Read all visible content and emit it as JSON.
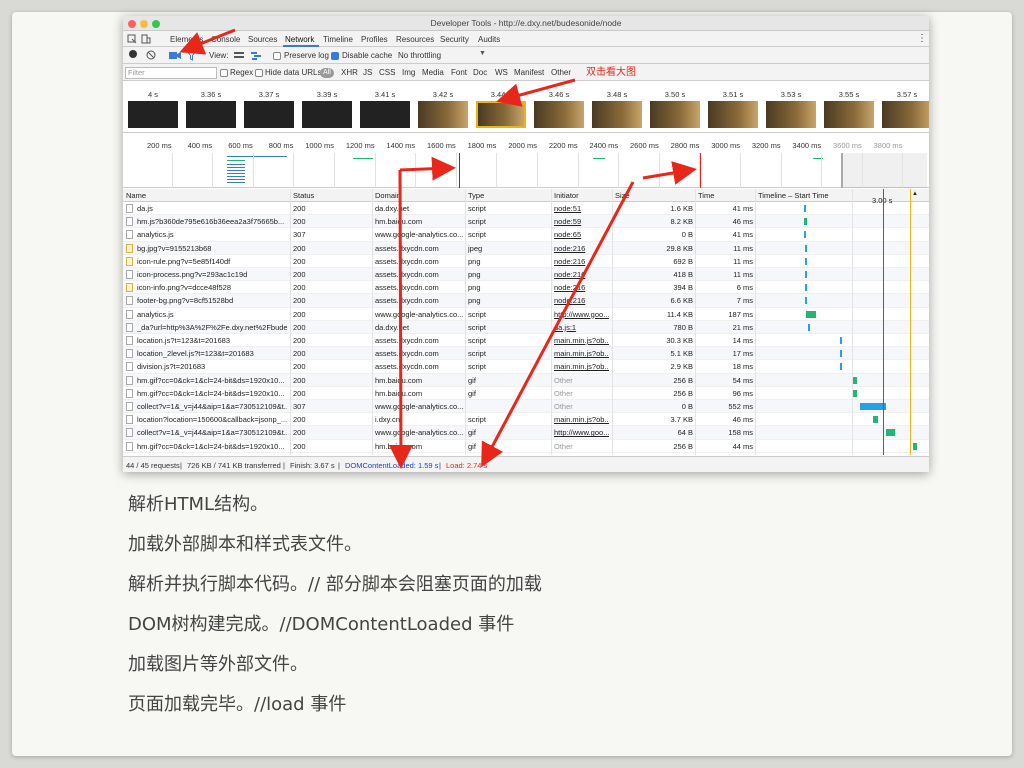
{
  "window": {
    "title": "Developer Tools - http://e.dxy.net/budesonide/node"
  },
  "tabs": [
    "Elements",
    "Console",
    "Sources",
    "Network",
    "Timeline",
    "Profiles",
    "Resources",
    "Security",
    "Audits"
  ],
  "toolbar": {
    "view_label": "View:",
    "preserve_log": "Preserve log",
    "disable_cache": "Disable cache",
    "throttle": "No throttling"
  },
  "filterbar": {
    "placeholder": "Filter",
    "regex": "Regex",
    "hide_data_urls": "Hide data URLs",
    "all": "All",
    "types": [
      "XHR",
      "JS",
      "CSS",
      "Img",
      "Media",
      "Font",
      "Doc",
      "WS",
      "Manifest",
      "Other"
    ]
  },
  "filmstrip": {
    "labels": [
      "4 s",
      "3.36 s",
      "3.37 s",
      "3.39 s",
      "3.41 s",
      "3.42 s",
      "3.44 s",
      "3.46 s",
      "3.48 s",
      "3.50 s",
      "3.51 s",
      "3.53 s",
      "3.55 s",
      "3.57 s"
    ]
  },
  "overview": {
    "labels": [
      "200 ms",
      "400 ms",
      "600 ms",
      "800 ms",
      "1000 ms",
      "1200 ms",
      "1400 ms",
      "1600 ms",
      "1800 ms",
      "2000 ms",
      "2200 ms",
      "2400 ms",
      "2600 ms",
      "2800 ms",
      "3000 ms",
      "3200 ms",
      "3400 ms",
      "3600 ms",
      "3800 ms"
    ]
  },
  "grid": {
    "headers": {
      "name": "Name",
      "status": "Status",
      "domain": "Domain",
      "type": "Type",
      "initiator": "Initiator",
      "size": "Size",
      "time": "Time",
      "timeline": "Timeline – Start Time",
      "timeline_mark": "3.00 s"
    },
    "rows": [
      {
        "name": "da.js",
        "status": "200",
        "domain": "da.dxy.net",
        "type": "script",
        "initiator": "node:51",
        "size": "1.6 KB",
        "time": "41 ms",
        "img": false,
        "ilink": true,
        "start": 0.287,
        "dur": 0.012,
        "color": "#27a0e8"
      },
      {
        "name": "hm.js?b360de795e616b36eea2a3f75665b...",
        "status": "200",
        "domain": "hm.baidu.com",
        "type": "script",
        "initiator": "node:59",
        "size": "8.2 KB",
        "time": "46 ms",
        "img": false,
        "ilink": true,
        "start": 0.289,
        "dur": 0.018,
        "color": "#22b573"
      },
      {
        "name": "analytics.js",
        "status": "307",
        "domain": "www.google-analytics.co...",
        "type": "script",
        "initiator": "node:65",
        "size": "0 B",
        "time": "41 ms",
        "img": false,
        "ilink": true,
        "start": 0.289,
        "dur": 0.01,
        "color": "#27a0e8"
      },
      {
        "name": "bg.jpg?v=9155213b68",
        "status": "200",
        "domain": "assets.dxycdn.com",
        "type": "jpeg",
        "initiator": "node:216",
        "size": "29.8 KB",
        "time": "11 ms",
        "img": true,
        "ilink": true,
        "start": 0.293,
        "dur": 0.008,
        "color": "#27a0e8"
      },
      {
        "name": "icon-rule.png?v=5e85f140df",
        "status": "200",
        "domain": "assets.dxycdn.com",
        "type": "png",
        "initiator": "node:216",
        "size": "692 B",
        "time": "11 ms",
        "img": true,
        "ilink": true,
        "start": 0.293,
        "dur": 0.008,
        "color": "#27a0e8"
      },
      {
        "name": "icon-process.png?v=293ac1c19d",
        "status": "200",
        "domain": "assets.dxycdn.com",
        "type": "png",
        "initiator": "node:216",
        "size": "418 B",
        "time": "11 ms",
        "img": false,
        "ilink": true,
        "start": 0.293,
        "dur": 0.008,
        "color": "#27a0e8"
      },
      {
        "name": "icon-info.png?v=dcce48f528",
        "status": "200",
        "domain": "assets.dxycdn.com",
        "type": "png",
        "initiator": "node:216",
        "size": "394 B",
        "time": "6 ms",
        "img": true,
        "ilink": true,
        "start": 0.293,
        "dur": 0.006,
        "color": "#27a0e8"
      },
      {
        "name": "footer-bg.png?v=8cf51528bd",
        "status": "200",
        "domain": "assets.dxycdn.com",
        "type": "png",
        "initiator": "node:216",
        "size": "6.6 KB",
        "time": "7 ms",
        "img": false,
        "ilink": true,
        "start": 0.293,
        "dur": 0.006,
        "color": "#27a0e8"
      },
      {
        "name": "analytics.js",
        "status": "200",
        "domain": "www.google-analytics.co...",
        "type": "script",
        "initiator": "http://www.goo...",
        "size": "11.4 KB",
        "time": "187 ms",
        "img": false,
        "ilink": true,
        "start": 0.303,
        "dur": 0.06,
        "color": "#22b573"
      },
      {
        "name": "_da?url=http%3A%2F%2Fe.dxy.net%2Fbude...",
        "status": "200",
        "domain": "da.dxy.net",
        "type": "script",
        "initiator": "da.js:1",
        "size": "780 B",
        "time": "21 ms",
        "img": false,
        "ilink": true,
        "start": 0.315,
        "dur": 0.01,
        "color": "#27a0e8"
      },
      {
        "name": "location.js?t=123&t=201683",
        "status": "200",
        "domain": "assets.dxycdn.com",
        "type": "script",
        "initiator": "main.min.js?ob...",
        "size": "30.3 KB",
        "time": "14 ms",
        "img": false,
        "ilink": true,
        "start": 0.512,
        "dur": 0.012,
        "color": "#27a0e8"
      },
      {
        "name": "location_2level.js?t=123&t=201683",
        "status": "200",
        "domain": "assets.dxycdn.com",
        "type": "script",
        "initiator": "main.min.js?ob...",
        "size": "5.1 KB",
        "time": "17 ms",
        "img": false,
        "ilink": true,
        "start": 0.512,
        "dur": 0.012,
        "color": "#27a0e8"
      },
      {
        "name": "division.js?t=201683",
        "status": "200",
        "domain": "assets.dxycdn.com",
        "type": "script",
        "initiator": "main.min.js?ob...",
        "size": "2.9 KB",
        "time": "18 ms",
        "img": false,
        "ilink": true,
        "start": 0.512,
        "dur": 0.012,
        "color": "#27a0e8"
      },
      {
        "name": "hm.gif?cc=0&ck=1&cl=24-bit&ds=1920x10...",
        "status": "200",
        "domain": "hm.baidu.com",
        "type": "gif",
        "initiator": "Other",
        "size": "256 B",
        "time": "54 ms",
        "img": false,
        "ilink": false,
        "start": 0.59,
        "dur": 0.03,
        "color": "#22b573"
      },
      {
        "name": "hm.gif?cc=0&ck=1&cl=24-bit&ds=1920x10...",
        "status": "200",
        "domain": "hm.baidu.com",
        "type": "gif",
        "initiator": "Other",
        "size": "256 B",
        "time": "96 ms",
        "img": false,
        "ilink": false,
        "start": 0.59,
        "dur": 0.03,
        "color": "#22b573"
      },
      {
        "name": "collect?v=1&_v=j44&aip=1&a=730512109&t...",
        "status": "307",
        "domain": "www.google-analytics.co...",
        "type": "",
        "initiator": "Other",
        "size": "0 B",
        "time": "552 ms",
        "img": false,
        "ilink": false,
        "start": 0.64,
        "dur": 0.16,
        "color": "#27a0e8"
      },
      {
        "name": "location?location=150600&callback=jsonp_...",
        "status": "200",
        "domain": "i.dxy.cn",
        "type": "script",
        "initiator": "main.min.js?ob...",
        "size": "3.7 KB",
        "time": "46 ms",
        "img": false,
        "ilink": true,
        "start": 0.72,
        "dur": 0.03,
        "color": "#22b573"
      },
      {
        "name": "collect?v=1&_v=j44&aip=1&a=730512109&t...",
        "status": "200",
        "domain": "www.google-analytics.co...",
        "type": "gif",
        "initiator": "http://www.goo...",
        "size": "64 B",
        "time": "158 ms",
        "img": false,
        "ilink": true,
        "start": 0.8,
        "dur": 0.055,
        "color": "#22b573"
      },
      {
        "name": "hm.gif?cc=0&ck=1&cl=24-bit&ds=1920x10...",
        "status": "200",
        "domain": "hm.baidu.com",
        "type": "gif",
        "initiator": "Other",
        "size": "256 B",
        "time": "44 ms",
        "img": false,
        "ilink": false,
        "start": 0.97,
        "dur": 0.025,
        "color": "#22b573"
      }
    ]
  },
  "statusbar": {
    "requests": "44 / 45 requests",
    "transferred": "726 KB / 741 KB transferred",
    "finish": "Finish: 3.67 s",
    "domcontentloaded": "DOMContentLoaded: 1.59 s",
    "load": "Load: 2.74 s"
  },
  "annotation": "双击看大图",
  "notes": [
    "解析HTML结构。",
    "加载外部脚本和样式表文件。",
    "解析并执行脚本代码。// 部分脚本会阻塞页面的加载",
    "DOM树构建完成。//DOMContentLoaded 事件",
    "加载图片等外部文件。",
    "页面加载完毕。//load 事件"
  ],
  "colors": {
    "accent": "#3879d9",
    "annotation_red": "#e8261a",
    "dcl_blue": "#1b3fd6",
    "load_red": "#e8261a"
  }
}
